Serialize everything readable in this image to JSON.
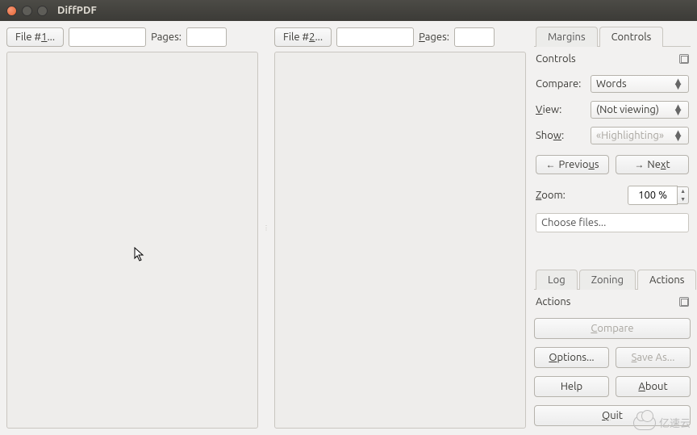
{
  "window": {
    "title": "DiffPDF"
  },
  "file1": {
    "button": "File #1...",
    "filename": "",
    "pages_label": "Pages:",
    "pages": ""
  },
  "file2": {
    "button": "File #2...",
    "filename": "",
    "pages_label": "Pages:",
    "pages": ""
  },
  "top_tabs": {
    "margins": "Margins",
    "controls": "Controls",
    "active": "Controls"
  },
  "controls": {
    "panel_title": "Controls",
    "compare_label": "Compare:",
    "compare_value": "Words",
    "view_label": "View:",
    "view_value": "(Not viewing)",
    "show_label": "Show:",
    "show_value": "«Highlighting»",
    "previous": "Previous",
    "next": "Next",
    "zoom_label": "Zoom:",
    "zoom_value": "100 %",
    "status": "Choose files..."
  },
  "bottom_tabs": {
    "log": "Log",
    "zoning": "Zoning",
    "actions": "Actions",
    "active": "Actions"
  },
  "actions": {
    "panel_title": "Actions",
    "compare": "Compare",
    "options": "Options...",
    "save_as": "Save As...",
    "help": "Help",
    "about": "About",
    "quit": "Quit"
  },
  "watermark": "亿速云"
}
